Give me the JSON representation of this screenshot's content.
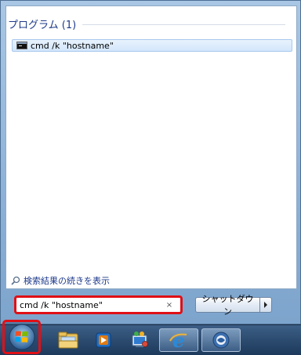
{
  "start_menu": {
    "group_title": "プログラム (1)",
    "results": [
      {
        "label": "cmd /k \"hostname\"",
        "icon": "console-icon"
      }
    ],
    "see_more_label": "検索結果の続きを表示",
    "search": {
      "value": "cmd /k \"hostname\"",
      "clear_icon": "×"
    },
    "shutdown_label": "シャットダウン"
  },
  "taskbar": {
    "items": [
      {
        "name": "start-orb",
        "icon": "windows-logo-icon"
      },
      {
        "name": "explorer",
        "icon": "folder-icon"
      },
      {
        "name": "media-player",
        "icon": "media-player-icon"
      },
      {
        "name": "control-panel",
        "icon": "control-panel-icon"
      },
      {
        "name": "internet-explorer",
        "icon": "internet-explorer-icon"
      },
      {
        "name": "app-5",
        "icon": "app-icon"
      }
    ]
  },
  "colors": {
    "highlight_red": "#e01016",
    "group_title": "#1e3a8a",
    "taskbar": "#2c4b6f"
  }
}
